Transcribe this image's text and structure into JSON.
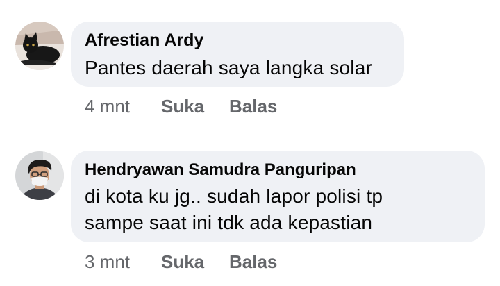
{
  "comments": [
    {
      "author": "Afrestian Ardy",
      "avatar_icon": "black-cat-avatar",
      "lines": [
        "Pantes daerah saya langka solar"
      ],
      "time": "4 mnt",
      "like_label": "Suka",
      "reply_label": "Balas"
    },
    {
      "author": "Hendryawan Samudra Panguripan",
      "avatar_icon": "masked-person-avatar",
      "lines": [
        "di kota ku jg.. sudah lapor polisi tp",
        "sampe saat ini tdk ada kepastian"
      ],
      "time": "3 mnt",
      "like_label": "Suka",
      "reply_label": "Balas"
    }
  ],
  "colors": {
    "bubble": "#eff1f5",
    "text": "#050505",
    "secondary": "#65676b"
  }
}
